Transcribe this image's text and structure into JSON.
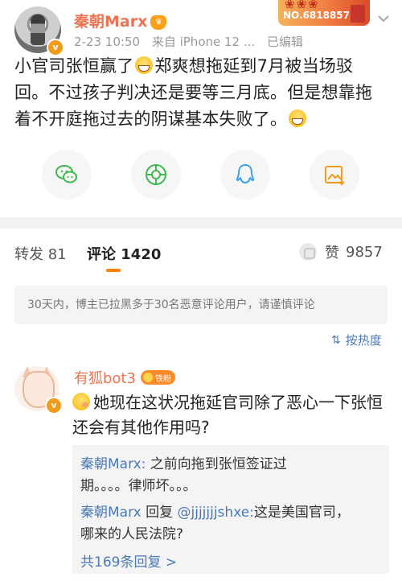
{
  "post": {
    "author": "秦朝Marx",
    "time": "2-23 10:50",
    "source": "来自 iPhone 12 ...",
    "edited": "已编辑",
    "fan_number": "NO.6818857",
    "text_line1": "小官司张恒赢了",
    "text_line1b": "郑爽想拖延到7月被当场驳",
    "text_line2": "回。不过孩子判决还是要等三月底。但是想靠拖",
    "text_line3": "着不开庭拖过去的阴谋基本失败了。"
  },
  "share": {
    "icons": [
      "wechat-icon",
      "moments-icon",
      "qq-icon",
      "save-image-icon"
    ]
  },
  "tabs": {
    "repost_label": "转发",
    "repost_count": "81",
    "comment_label": "评论",
    "comment_count": "1420",
    "like_label": "赞",
    "like_count": "9857"
  },
  "notice": "30天内，博主已拉黑多于30名恶意评论用户，请谨慎评论",
  "sort_label": "按热度",
  "comment": {
    "author": "有狐bot3",
    "badge": "铁粉",
    "text_line1": "她现在这状况拖延官司除了恶心一下张恒",
    "text_line2": "还会有其他作用吗?",
    "replies": [
      {
        "name": "秦朝Marx:",
        "line1": " 之前向拖到张恒签证过",
        "line2": "期。。。。律师坏。。。"
      },
      {
        "name": "秦朝Marx",
        "mid": " 回复 ",
        "at": "@jjjjjjjshxe:",
        "line1_rest": "这是美国官司，",
        "line2": "哪来的人民法院?"
      }
    ],
    "more_replies": "共169条回复 >"
  },
  "colors": {
    "name_orange": "#eb7350",
    "link_blue": "#4b7ab8",
    "accent_orange": "#ff8200"
  }
}
